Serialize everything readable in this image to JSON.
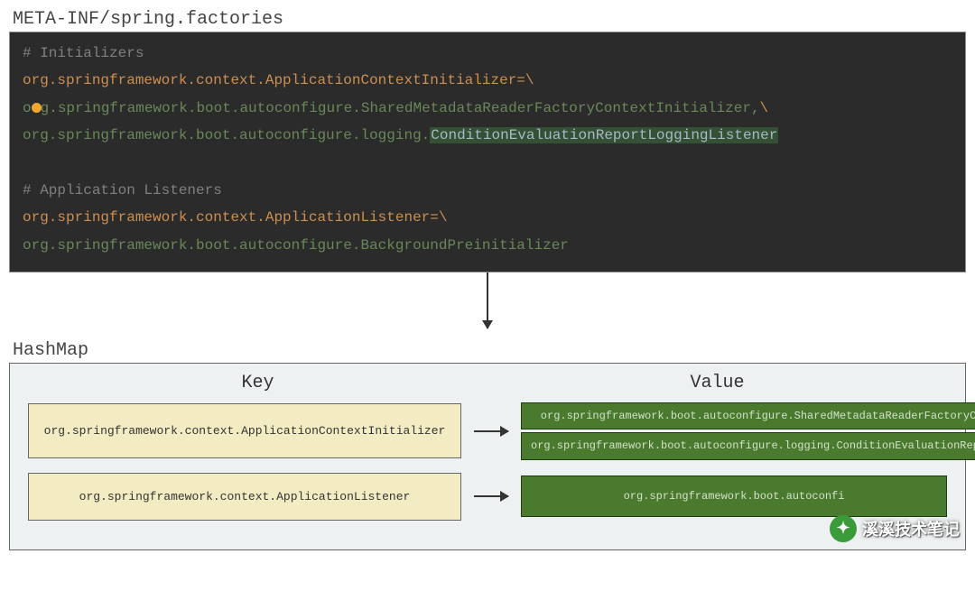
{
  "file_title": "META-INF/spring.factories",
  "code": {
    "comment1": "# Initializers",
    "line2_key": "org.springframework.context.ApplicationContextInitializer=",
    "line2_bs": "\\",
    "line3_prefix": "o",
    "line3_rest": "g.springframework.boot.autoconfigure.SharedMetadataReaderFactoryContextInitializer,",
    "line3_bs": "\\",
    "line4_prefix": "org.springframework.boot.autoconfigure.logging.",
    "line4_highlight": "ConditionEvaluationReportLoggingListener",
    "blank": " ",
    "comment2": "# Application Listeners",
    "line7_key": "org.springframework.context.ApplicationListener=",
    "line7_bs": "\\",
    "line8_val": "org.springframework.boot.autoconfigure.BackgroundPreinitializer"
  },
  "hashmap_title": "HashMap",
  "headers": {
    "key": "Key",
    "value": "Value"
  },
  "rows": [
    {
      "key": "org.springframework.context.ApplicationContextInitializer",
      "values": [
        "org.springframework.boot.autoconfigure.SharedMetadataReaderFactoryContextInitializer",
        "org.springframework.boot.autoconfigure.logging.ConditionEvaluationReportLoggingListener"
      ]
    },
    {
      "key": "org.springframework.context.ApplicationListener",
      "values": [
        "org.springframework.boot.autoconfi"
      ]
    }
  ],
  "watermark": "溪溪技术笔记"
}
